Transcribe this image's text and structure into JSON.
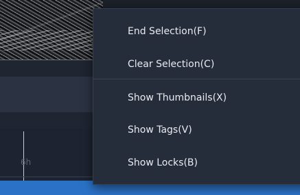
{
  "timeline": {
    "ruler_label": "6h"
  },
  "context_menu": {
    "items": [
      {
        "label": "End Selection(F)"
      },
      {
        "label": "Clear Selection(C)"
      },
      {
        "label": "Show Thumbnails(X)"
      },
      {
        "label": "Show Tags(V)"
      },
      {
        "label": "Show Locks(B)"
      }
    ]
  }
}
